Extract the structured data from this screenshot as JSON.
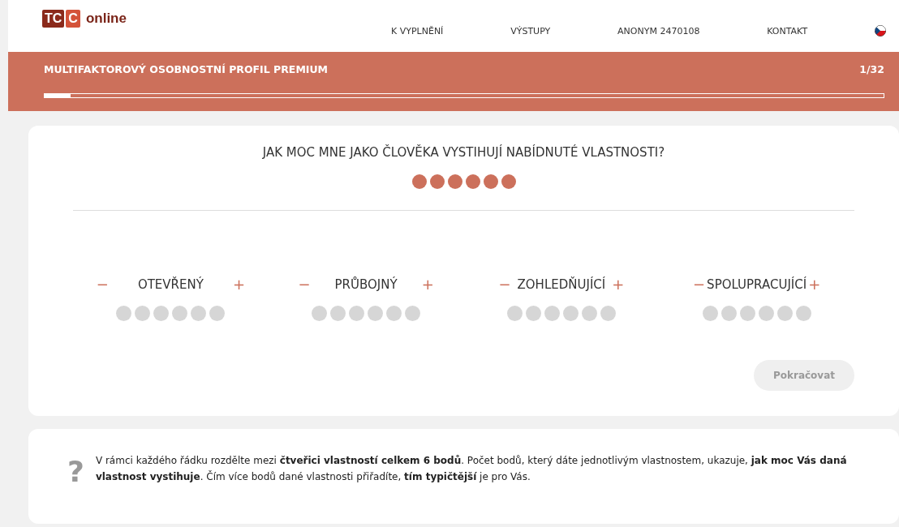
{
  "logo": {
    "letters": [
      "T",
      "C",
      "C"
    ],
    "word": "online"
  },
  "nav": [
    {
      "label": "K VYPLNĚNÍ"
    },
    {
      "label": "VÝSTUPY"
    },
    {
      "label": "ANONYM 2470108"
    },
    {
      "label": "KONTAKT"
    }
  ],
  "banner": {
    "title": "MULTIFAKTOROVÝ OSOBNOSTNÍ PROFIL PREMIUM",
    "counter": "1/32",
    "level": 0.031
  },
  "question": {
    "title": "JAK MOC MNE JAKO ČLOVĚKA VYSTIHUJÍ NABÍDNUTÉ VLASTNOSTI?",
    "stars": 6
  },
  "traits": [
    {
      "minus": "−",
      "label": "OTEVŘENÝ",
      "plus": "+",
      "stars": 0
    },
    {
      "minus": "−",
      "label": "PRŮBOJNÝ",
      "plus": "+",
      "stars": 0
    },
    {
      "minus": "−",
      "label": "ZOHLEDŇUJÍCÍ",
      "plus": "+",
      "stars": 0
    },
    {
      "minus": "−",
      "label": "SPOLUPRACUJÍCÍ",
      "plus": "+",
      "stars": 0
    }
  ],
  "continue_button": {
    "label": "Pokračovat",
    "disabled": true
  },
  "help": {
    "icon": "?",
    "text": "V rámci každého řádku rozdělte mezi **čtveřici vlastností celkem 6 bodů**. Počet bodů, který dáte jednotlivým vlastnostem, ukazuje, **jak moc Vás daná vlastnost vystihuje**. Čím více bodů dané vlastnosti přiřadíte, **tím typičtější** je pro Vás."
  }
}
